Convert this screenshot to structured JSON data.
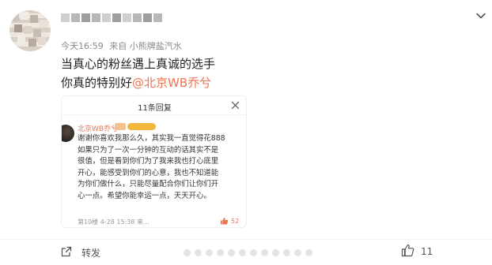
{
  "post": {
    "meta": {
      "time": "今天16:59",
      "source": "来自 小熊牌盐汽水"
    },
    "text_line1": "当真心的粉丝遇上真诚的选手",
    "text_line2_prefix": "你真的特别好",
    "mention": "@北京WB乔兮"
  },
  "replies_card": {
    "title": "11条回复",
    "comment": {
      "author": "北京WB乔兮",
      "lines": [
        "谢谢你喜欢我那么久，其实我一直觉得花888",
        "如果只为了一次一分钟的互动的话其实不是",
        "很值，但是看到你们为了我来我也打心底里",
        "开心，能感受到你们的心意，我也不知道能",
        "为你们做什么，只能尽量配合你们让你们开",
        "心一点。希望你能幸运一点，天天开心。"
      ],
      "footer": "第10楼  4-28 15:38  来...",
      "likes": "52"
    }
  },
  "actions": {
    "share_label": "转发",
    "like_count": "11"
  },
  "colors": {
    "accent": "#eb7350",
    "meta_text": "#8a8a8a"
  }
}
